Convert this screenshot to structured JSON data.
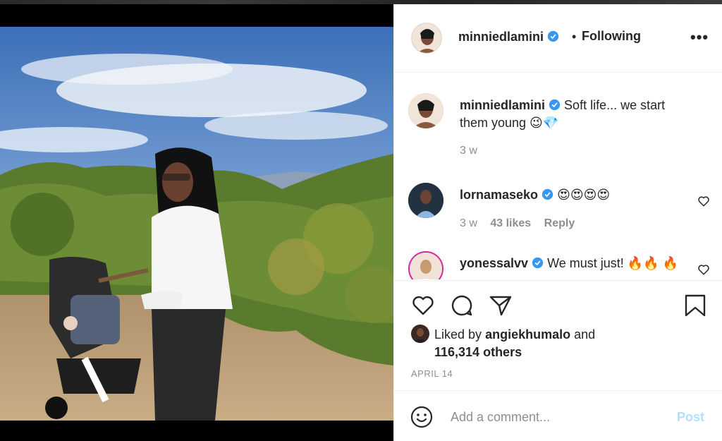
{
  "header": {
    "username": "minniedlamini",
    "separator": "•",
    "follow_status": "Following",
    "more": "•••"
  },
  "comments": [
    {
      "username": "minniedlamini",
      "text": "Soft life... we start them young 😉💎",
      "time": "3 w"
    },
    {
      "username": "lornamaseko",
      "text": "😍😍😍😍",
      "time": "3 w",
      "likes": "43 likes",
      "reply": "Reply"
    },
    {
      "username": "yonessalvv",
      "text": "We must just! 🔥🔥 🔥",
      "time": ""
    }
  ],
  "likes": {
    "prefix": "Liked by",
    "user": "angiekhumalo",
    "conj": "and",
    "others": "116,314 others"
  },
  "date": "APRIL 14",
  "add_comment": {
    "placeholder": "Add a comment...",
    "post_label": "Post"
  },
  "colors": {
    "verified": "#3897f0",
    "post_disabled": "#b2dffc",
    "meta": "#8e8e8e"
  }
}
